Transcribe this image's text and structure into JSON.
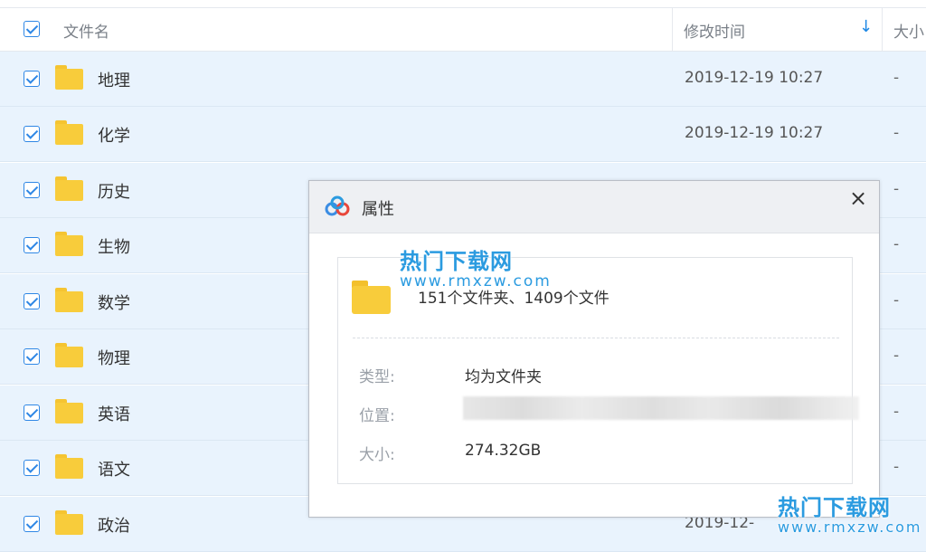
{
  "header": {
    "name_col": "文件名",
    "time_col": "修改时间",
    "sort_icon": "↓",
    "size_col": "大小"
  },
  "rows": [
    {
      "name": "地理",
      "time": "2019-12-19 10:27",
      "size": "-"
    },
    {
      "name": "化学",
      "time": "2019-12-19 10:27",
      "size": "-"
    },
    {
      "name": "历史",
      "time": "",
      "size": "-"
    },
    {
      "name": "生物",
      "time": "",
      "size": "-"
    },
    {
      "name": "数学",
      "time": "",
      "size": "-"
    },
    {
      "name": "物理",
      "time": "",
      "size": "-"
    },
    {
      "name": "英语",
      "time": "",
      "size": "-"
    },
    {
      "name": "语文",
      "time": "",
      "size": "-"
    },
    {
      "name": "政治",
      "time": "2019-12-",
      "size": ""
    }
  ],
  "dialog": {
    "title": "属性",
    "close_icon": "×",
    "summary": "151个文件夹、1409个文件",
    "type_label": "类型:",
    "type_value": "均为文件夹",
    "location_label": "位置:",
    "size_label": "大小:",
    "size_value": "274.32GB"
  },
  "watermark": {
    "text": "热门下载网",
    "url": "www.rmxzw.com"
  },
  "colors": {
    "accent": "#2f87e5",
    "row_selected_bg": "#e9f3fd",
    "folder_yellow": "#f8cc3b"
  }
}
